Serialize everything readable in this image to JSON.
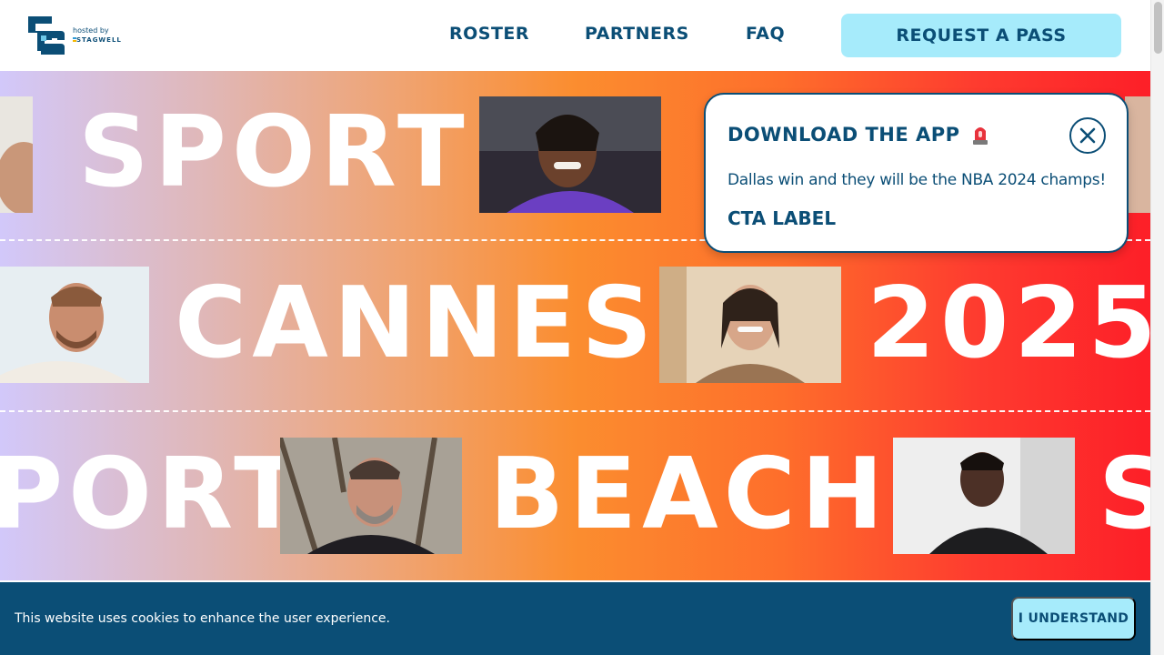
{
  "header": {
    "logo_hosted_text": "hosted by",
    "logo_partner_text": "STAGWELL",
    "nav": [
      "ROSTER",
      "PARTNERS",
      "FAQ"
    ],
    "cta_label": "REQUEST A PASS"
  },
  "hero": {
    "row1": {
      "word1": "SPORT"
    },
    "row2": {
      "word1": "CANNES",
      "word2": "2025"
    },
    "row3": {
      "word1": "PORT",
      "word2": "BEACH",
      "word3": "S"
    }
  },
  "popup": {
    "title": "DOWNLOAD THE APP",
    "title_icon": "siren-icon",
    "message": "Dallas win and they will be the NBA 2024 champs!",
    "cta_label": "CTA LABEL",
    "close_icon": "close-icon"
  },
  "cookie_bar": {
    "message": "This website uses cookies to enhance the user experience.",
    "button_label": "I UNDERSTAND"
  },
  "colors": {
    "brand_dark": "#0b4e76",
    "brand_light": "#a6ebfb",
    "hero_gradient_start": "#d2c8fa",
    "hero_gradient_mid": "#fb8d2f",
    "hero_gradient_end": "#fd1f28"
  }
}
